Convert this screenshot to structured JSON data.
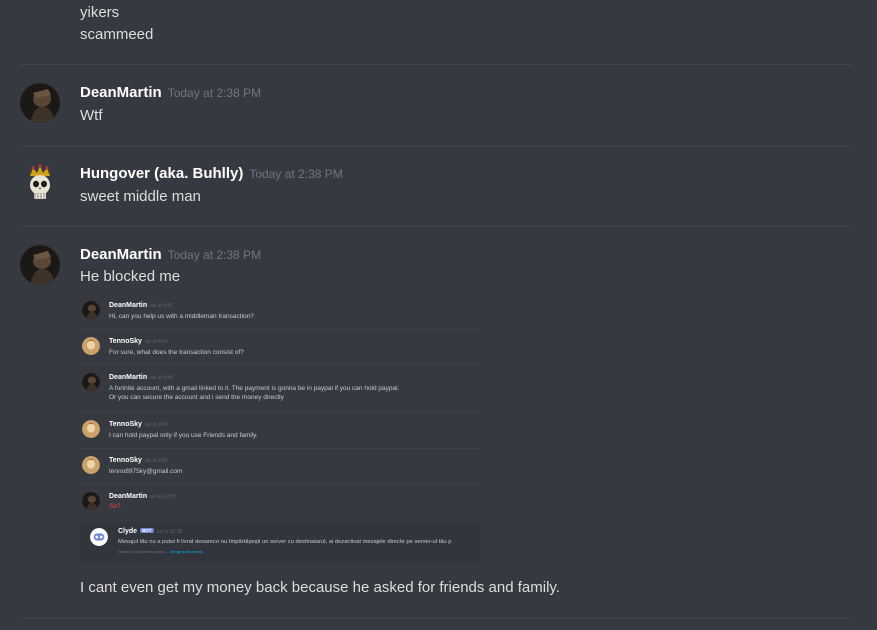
{
  "top_lines": [
    "yikers",
    "scammeed"
  ],
  "messages": [
    {
      "author": "DeanMartin",
      "timestamp": "Today at 2:38 PM",
      "text": "Wtf"
    },
    {
      "author": "Hungover (aka. Buhlly)",
      "timestamp": "Today at 2:38 PM",
      "text": "sweet middle man"
    },
    {
      "author": "DeanMartin",
      "timestamp": "Today at 2:38 PM",
      "text": "He blocked me"
    }
  ],
  "embedded": {
    "messages": [
      {
        "author": "DeanMartin",
        "timestamp": "azi la 8:41",
        "lines": [
          "Hi, can you help us with  a middleman transaction?"
        ]
      },
      {
        "author": "TennoSky",
        "timestamp": "azi la 8:43",
        "lines": [
          "For sure, what does the transaction consist of?"
        ]
      },
      {
        "author": "DeanMartin",
        "timestamp": "azi la 8:44",
        "lines": [
          "A fortnite account, with a gmail linked to it. The payment is gonna be in paypal if you can hold paypal.",
          "Or you can secure the account and i send the money directly"
        ]
      },
      {
        "author": "TennoSky",
        "timestamp": "azi la 8:45",
        "lines": [
          "I can hold paypal only if you use Friends and family."
        ]
      },
      {
        "author": "TennoSky",
        "timestamp": "azi la 8:46",
        "lines": [
          "tenno8975ky@gmail.com"
        ]
      },
      {
        "author": "DeanMartin",
        "timestamp": "azi la 10:38",
        "lines": [
          "Sir?"
        ]
      }
    ],
    "clyde": {
      "author": "Clyde",
      "bot_tag": "BOT",
      "timestamp": "azi la 10:38",
      "text": "Mesajul tău nu a putut fi livrat deoarece nu împărtășești un server cu destinatarul, ai dezactivat mesajele directe pe server-ul tău p",
      "footer": "Numai tu poți vedea aceste —",
      "footer_link": "Șterge acest mesaj"
    }
  },
  "final_line": "I cant even get my money back because he asked for friends and family."
}
